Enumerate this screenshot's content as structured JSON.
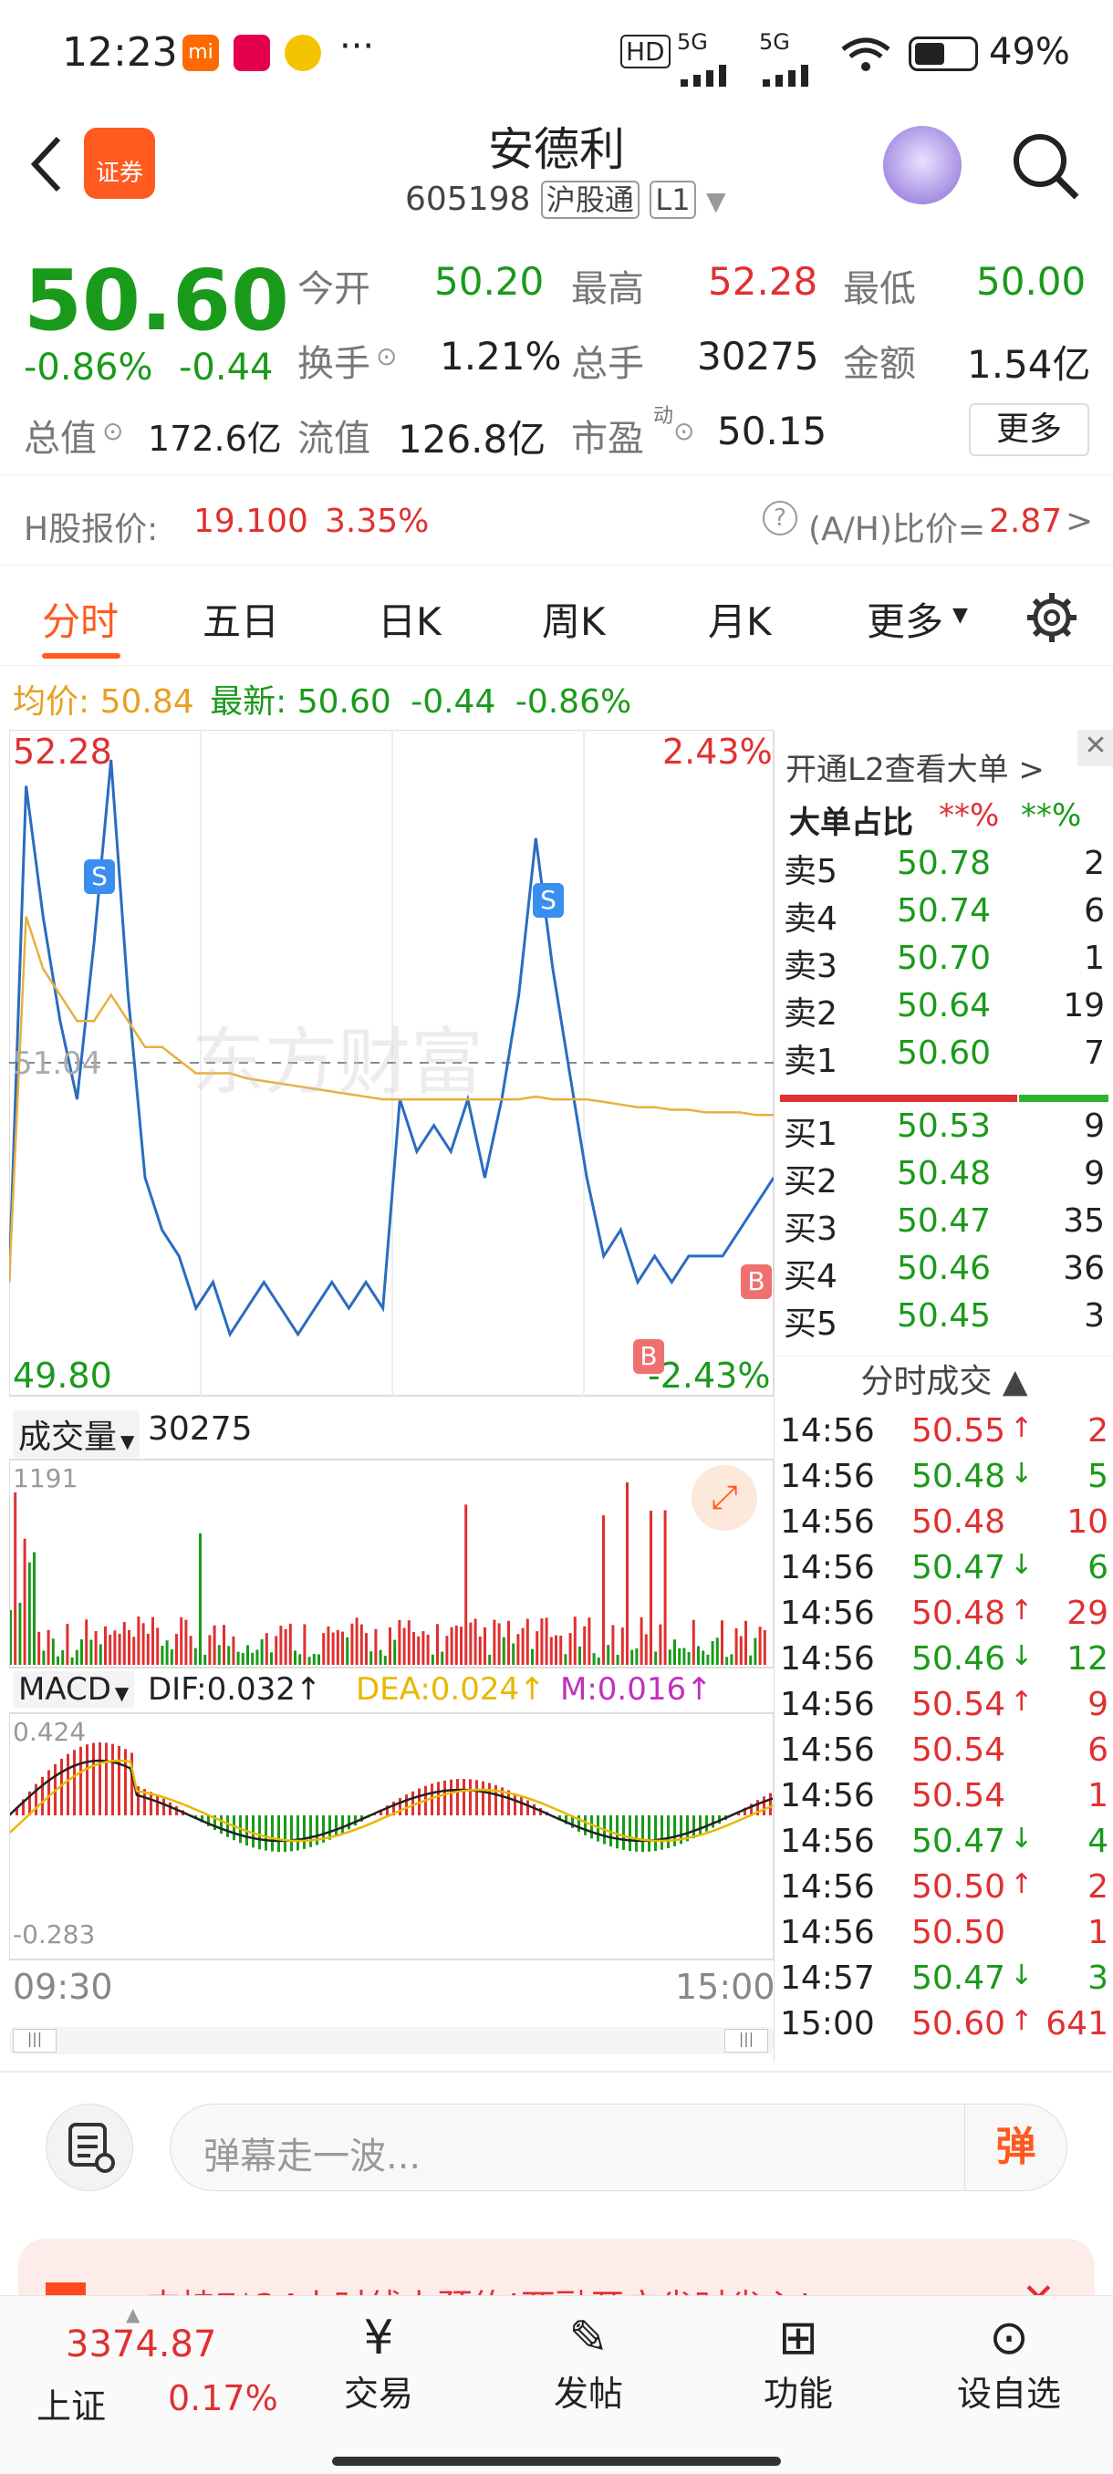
{
  "status_bar": {
    "time": "12:23",
    "net1": "HD",
    "net2": "5G",
    "net3": "5G",
    "battery": "49%"
  },
  "header": {
    "title": "安德利",
    "code": "605198",
    "badge1": "沪股通",
    "badge2": "L1",
    "broker_logo": "证券"
  },
  "quote": {
    "price": "50.60",
    "change_pct": "-0.86%",
    "change": "-0.44",
    "open_label": "今开",
    "open": "50.20",
    "high_label": "最高",
    "high": "52.28",
    "low_label": "最低",
    "low": "50.00",
    "turnover_label": "换手",
    "turnover": "1.21%",
    "volume_label": "总手",
    "volume": "30275",
    "amount_label": "金额",
    "amount": "1.54亿",
    "mktcap_label": "总值",
    "mktcap": "172.6亿",
    "float_label": "流值",
    "float": "126.8亿",
    "pe_label": "市盈",
    "pe_sup": "动",
    "pe": "50.15",
    "more": "更多"
  },
  "h_share": {
    "label": "H股报价:",
    "price": "19.100",
    "pct": "3.35%",
    "ah_label": "(A/H)比价=",
    "ah_value": "2.87"
  },
  "tabs": [
    "分时",
    "五日",
    "日K",
    "周K",
    "月K",
    "更多"
  ],
  "avg_info": {
    "avg_label": "均价:",
    "avg": "50.84",
    "last_label": "最新:",
    "last": "50.60",
    "chg": "-0.44",
    "pct": "-0.86%"
  },
  "chart_labels": {
    "top_price": "52.28",
    "top_pct": "2.43%",
    "bottom_price": "49.80",
    "bottom_pct": "-2.43%",
    "mid_price": "51.04",
    "watermark": "东方财富",
    "vol_label": "成交量",
    "vol_value": "30275",
    "vol_max": "1191",
    "macd_label": "MACD",
    "dif": "DIF:0.032",
    "dea": "DEA:0.024",
    "m": "M:0.016",
    "macd_top": "0.424",
    "macd_bottom": "-0.283",
    "time_start": "09:30",
    "time_end": "15:00",
    "sell_marker": "S",
    "buy_marker": "B"
  },
  "chart_data": {
    "type": "line",
    "title": "",
    "ylim": [
      49.8,
      52.28
    ],
    "series": [
      {
        "name": "",
        "values": [
          50.2,
          52.1,
          51.6,
          51.2,
          50.9,
          51.5,
          52.2,
          51.3,
          50.6,
          50.4,
          50.3,
          50.1,
          50.2,
          50.0,
          50.1,
          50.2,
          50.1,
          50.0,
          50.1,
          50.2,
          50.1,
          50.2,
          50.1,
          50.9,
          50.7,
          50.8,
          50.7,
          50.9,
          50.6,
          50.9,
          51.3,
          51.9,
          51.4,
          51.0,
          50.6,
          50.3,
          50.4,
          50.2,
          50.3,
          50.2,
          50.3,
          50.3,
          50.3,
          50.4,
          50.5,
          50.6
        ]
      },
      {
        "name": "",
        "values": [
          50.2,
          51.6,
          51.4,
          51.3,
          51.2,
          51.2,
          51.3,
          51.2,
          51.1,
          51.1,
          51.05,
          51.0,
          51.0,
          51.0,
          50.98,
          50.97,
          50.96,
          50.95,
          50.94,
          50.93,
          50.92,
          50.91,
          50.9,
          50.9,
          50.9,
          50.9,
          50.9,
          50.9,
          50.9,
          50.9,
          50.9,
          50.91,
          50.9,
          50.9,
          50.9,
          50.89,
          50.88,
          50.87,
          50.87,
          50.86,
          50.86,
          50.85,
          50.85,
          50.85,
          50.84,
          50.84
        ]
      }
    ]
  },
  "orderbook": {
    "link": "开通L2查看大单",
    "big_label": "大单占比",
    "big_red": "**%",
    "big_green": "**%",
    "asks": [
      {
        "l": "卖5",
        "p": "50.78",
        "v": "2"
      },
      {
        "l": "卖4",
        "p": "50.74",
        "v": "6"
      },
      {
        "l": "卖3",
        "p": "50.70",
        "v": "1"
      },
      {
        "l": "卖2",
        "p": "50.64",
        "v": "19"
      },
      {
        "l": "卖1",
        "p": "50.60",
        "v": "7"
      }
    ],
    "bids": [
      {
        "l": "买1",
        "p": "50.53",
        "v": "9"
      },
      {
        "l": "买2",
        "p": "50.48",
        "v": "9"
      },
      {
        "l": "买3",
        "p": "50.47",
        "v": "35"
      },
      {
        "l": "买4",
        "p": "50.46",
        "v": "36"
      },
      {
        "l": "买5",
        "p": "50.45",
        "v": "3"
      }
    ],
    "trades_label": "分时成交",
    "trades": [
      {
        "t": "14:56",
        "p": "50.55",
        "d": "↑",
        "v": "2",
        "c": "red"
      },
      {
        "t": "14:56",
        "p": "50.48",
        "d": "↓",
        "v": "5",
        "c": "green"
      },
      {
        "t": "14:56",
        "p": "50.48",
        "d": "",
        "v": "10",
        "c": "red"
      },
      {
        "t": "14:56",
        "p": "50.47",
        "d": "↓",
        "v": "6",
        "c": "green"
      },
      {
        "t": "14:56",
        "p": "50.48",
        "d": "↑",
        "v": "29",
        "c": "red"
      },
      {
        "t": "14:56",
        "p": "50.46",
        "d": "↓",
        "v": "12",
        "c": "green"
      },
      {
        "t": "14:56",
        "p": "50.54",
        "d": "↑",
        "v": "9",
        "c": "red"
      },
      {
        "t": "14:56",
        "p": "50.54",
        "d": "",
        "v": "6",
        "c": "red"
      },
      {
        "t": "14:56",
        "p": "50.54",
        "d": "",
        "v": "1",
        "c": "red"
      },
      {
        "t": "14:56",
        "p": "50.47",
        "d": "↓",
        "v": "4",
        "c": "green"
      },
      {
        "t": "14:56",
        "p": "50.50",
        "d": "↑",
        "v": "2",
        "c": "red"
      },
      {
        "t": "14:56",
        "p": "50.50",
        "d": "",
        "v": "1",
        "c": "red"
      },
      {
        "t": "14:57",
        "p": "50.47",
        "d": "↓",
        "v": "3",
        "c": "green"
      },
      {
        "t": "15:00",
        "p": "50.60",
        "d": "↑",
        "v": "641",
        "c": "red"
      }
    ]
  },
  "comment": {
    "placeholder": "弹幕走一波...",
    "danmu": "弹"
  },
  "banner": {
    "text": "支持7*24小时线上预约!两融开户省时省心!"
  },
  "bottom_nav": {
    "index_value": "3374.87",
    "index_name": "上证",
    "index_pct": "0.17%",
    "items": [
      "交易",
      "发帖",
      "功能",
      "设自选"
    ]
  }
}
